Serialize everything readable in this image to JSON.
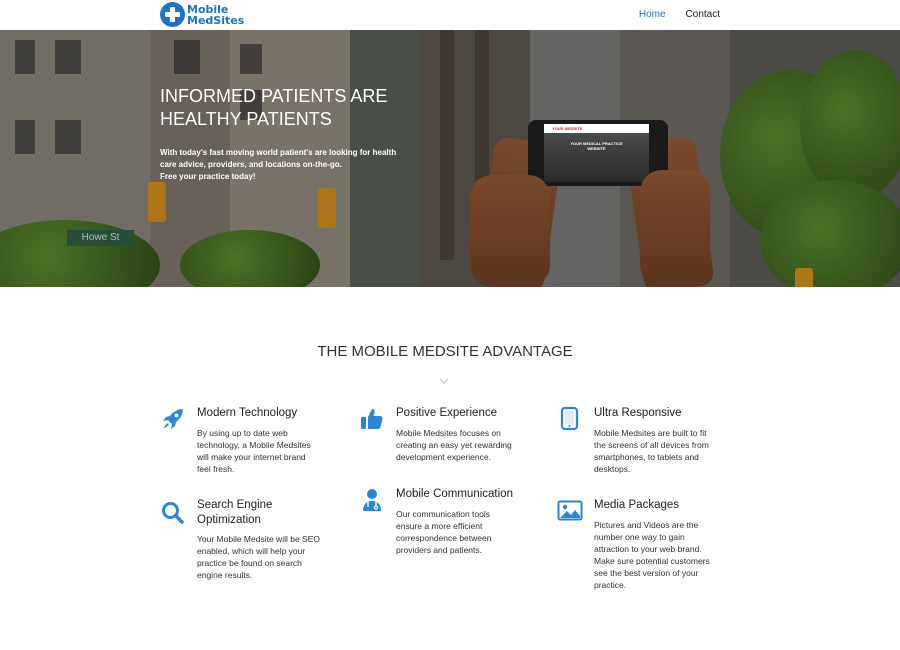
{
  "header": {
    "logo_line1": "Mobile",
    "logo_line2": "MedSites",
    "nav": [
      {
        "label": "Home",
        "active": true
      },
      {
        "label": "Contact",
        "active": false
      }
    ]
  },
  "hero": {
    "title_line1": "INFORMED PATIENTS ARE",
    "title_line2": "HEALTHY PATIENTS",
    "subtitle_line1": "With today's fast moving world patient's are looking for health",
    "subtitle_line2": "care advice, providers, and locations on-the-go.",
    "subtitle_line3": "Free your practice today!",
    "street_sign": "Howe St",
    "phone_header": "YOUR MEDSITE",
    "phone_title_line1": "YOUR MEDICAL PRACTICE",
    "phone_title_line2": "WEBSITE"
  },
  "advantages": {
    "title": "THE MOBILE MEDSITE ADVANTAGE",
    "features": [
      {
        "icon": "rocket-icon",
        "title_lines": [
          "Modern Technology"
        ],
        "desc_lines": [
          "By using up to date web",
          "technology, a Mobile Medsites",
          "will make your internet brand",
          "feel fresh."
        ]
      },
      {
        "icon": "thumbs-up-icon",
        "title_lines": [
          "Positive Experience"
        ],
        "desc_lines": [
          "Mobile Medsites focuses on",
          "creating an easy yet rewarding",
          "development experience."
        ]
      },
      {
        "icon": "tablet-icon",
        "title_lines": [
          "Ultra Responsive"
        ],
        "desc_lines": [
          "Mobile Medsites are built to fit",
          "the screens of all devices from",
          "smartphones, to tablets and",
          "desktops."
        ]
      },
      {
        "icon": "search-icon",
        "title_lines": [
          "Search Engine",
          "Optimization"
        ],
        "desc_lines": [
          "Your Mobile Medsite will be SEO",
          "enabled, which will help your",
          "practice be found on search",
          "engine results."
        ]
      },
      {
        "icon": "doctor-icon",
        "title_lines": [
          "Mobile Communication"
        ],
        "desc_lines": [
          "Our communication tools",
          "ensure a more efficient",
          "correspondence between",
          "providers and patients."
        ]
      },
      {
        "icon": "image-icon",
        "title_lines": [
          "Media Packages"
        ],
        "desc_lines": [
          "Pictures and Videos are the",
          "number one way to gain",
          "attraction to your web brand.",
          "Make sure potential customers",
          "see the best version of your",
          "practice."
        ]
      }
    ]
  },
  "colors": {
    "accent": "#1e72c8",
    "icon": "#2b86d6"
  }
}
